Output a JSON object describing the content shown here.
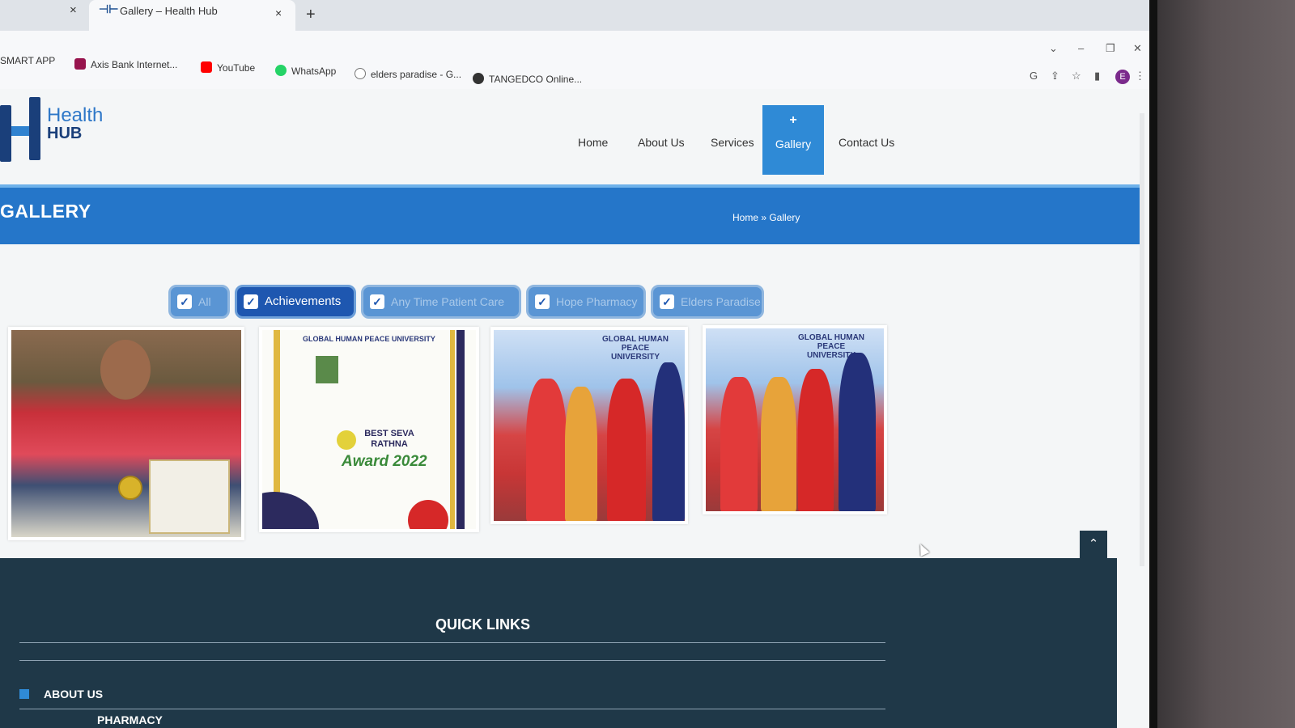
{
  "browser": {
    "prev_tab_close": "×",
    "active_tab": {
      "title": "Gallery – Health Hub",
      "close": "×"
    },
    "new_tab": "+",
    "bookmarks": [
      {
        "label": "SMART APP",
        "icon": "smart-app-icon",
        "color": "#999999"
      },
      {
        "label": "Axis Bank Internet...",
        "icon": "axis-bank-icon",
        "color": "#97144d"
      },
      {
        "label": "YouTube",
        "icon": "youtube-icon",
        "color": "#ff0000"
      },
      {
        "label": "WhatsApp",
        "icon": "whatsapp-icon",
        "color": "#25d366"
      },
      {
        "label": "elders paradise - G...",
        "icon": "google-icon",
        "color": "#555555"
      },
      {
        "label": "TANGEDCO Online...",
        "icon": "globe-icon",
        "color": "#333333"
      }
    ],
    "profile_initial": "E"
  },
  "site": {
    "logo": {
      "line1": "Health",
      "line2": "HUB"
    },
    "nav": [
      {
        "label": "Home"
      },
      {
        "label": "About Us"
      },
      {
        "label": "Services"
      },
      {
        "label": "Gallery",
        "active": true,
        "icon": "plus-icon"
      },
      {
        "label": "Contact Us"
      }
    ],
    "page_title": "GALLERY",
    "breadcrumb": "Home » Gallery",
    "filters": [
      {
        "label": "All",
        "checked": true,
        "selected": false
      },
      {
        "label": "Achievements",
        "checked": true,
        "selected": true
      },
      {
        "label": "Any Time Patient Care",
        "checked": true,
        "selected": false
      },
      {
        "label": "Hope Pharmacy",
        "checked": true,
        "selected": false
      },
      {
        "label": "Elders Paradise",
        "checked": true,
        "selected": false
      }
    ],
    "gallery": {
      "cert_header": "GLOBAL HUMAN PEACE UNIVERSITY",
      "cert_award_line1": "BEST SEVA RATHNA",
      "cert_award_line2": "Award 2022",
      "photo_banner": "GLOBAL HUMAN PEACE UNIVERSITY"
    },
    "footer": {
      "heading": "QUICK LINKS",
      "links": [
        "ABOUT US",
        "PHARMACY"
      ]
    }
  },
  "colors": {
    "primary_blue": "#2576c9",
    "nav_active": "#2f8ad6",
    "chip_selected": "#1e57b0",
    "footer_bg": "#1f3848"
  }
}
